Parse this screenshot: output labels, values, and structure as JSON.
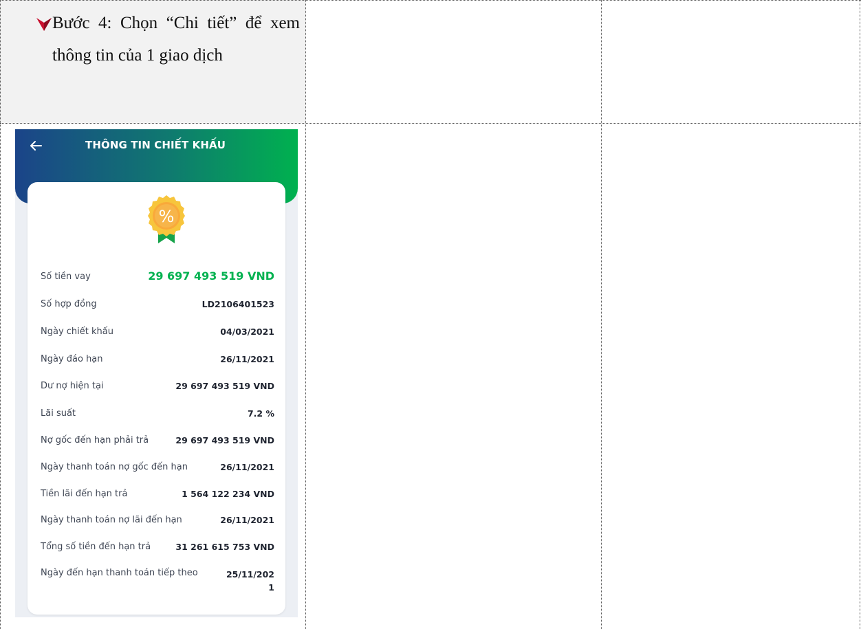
{
  "step": {
    "text": "Bước 4: Chọn “Chi tiết” để xem thông tin của 1 giao dịch",
    "bullet_color": "#c8102e"
  },
  "screen": {
    "title": "THÔNG TIN CHIẾT KHẤU",
    "badge_symbol": "%",
    "colors": {
      "gradient_start": "#1b4489",
      "gradient_end": "#00b14f",
      "highlight": "#00b14f"
    },
    "rows": [
      {
        "label": "Số tiền vay",
        "value": "29 697 493 519 VND"
      },
      {
        "label": "Số hợp đồng",
        "value": "LD2106401523"
      },
      {
        "label": "Ngày chiết khấu",
        "value": "04/03/2021"
      },
      {
        "label": "Ngày đáo hạn",
        "value": "26/11/2021"
      },
      {
        "label": "Dư nợ hiện tại",
        "value": "29 697 493 519 VND"
      },
      {
        "label": "Lãi suất",
        "value": "7.2 %"
      },
      {
        "label": "Nợ gốc đến hạn phải trả",
        "value": "29 697 493 519 VND"
      },
      {
        "label": "Ngày thanh toán nợ gốc đến hạn",
        "value": "26/11/2021"
      },
      {
        "label": "Tiền lãi đến hạn trả",
        "value": "1 564 122 234 VND"
      },
      {
        "label": "Ngày thanh toán nợ lãi đến hạn",
        "value": "26/11/2021"
      },
      {
        "label": "Tổng số tiền đến hạn trả",
        "value": "31 261 615 753 VND"
      },
      {
        "label": "Ngày đến hạn thanh toán tiếp theo",
        "value": "25/11/2021"
      }
    ]
  }
}
